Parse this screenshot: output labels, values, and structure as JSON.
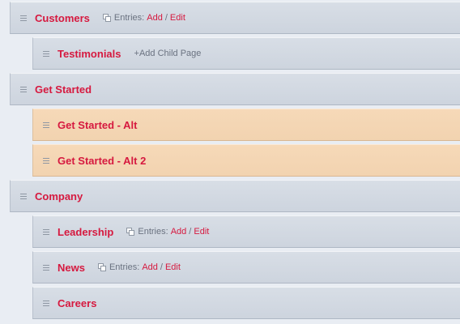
{
  "pages": [
    {
      "title": "Customers",
      "entries_label": "Entries:",
      "add": "Add",
      "sep": "/",
      "edit": "Edit"
    },
    {
      "title": "Testimonials",
      "child_link": "+Add Child Page"
    },
    {
      "title": "Get Started"
    },
    {
      "title": "Get Started - Alt"
    },
    {
      "title": "Get Started - Alt 2"
    },
    {
      "title": "Company"
    },
    {
      "title": "Leadership",
      "entries_label": "Entries:",
      "add": "Add",
      "sep": "/",
      "edit": "Edit"
    },
    {
      "title": "News",
      "entries_label": "Entries:",
      "add": "Add",
      "sep": "/",
      "edit": "Edit"
    },
    {
      "title": "Careers"
    }
  ],
  "colors": {
    "link": "#d6193f",
    "row": "#d4dae2",
    "highlight": "#f4d6b4"
  }
}
